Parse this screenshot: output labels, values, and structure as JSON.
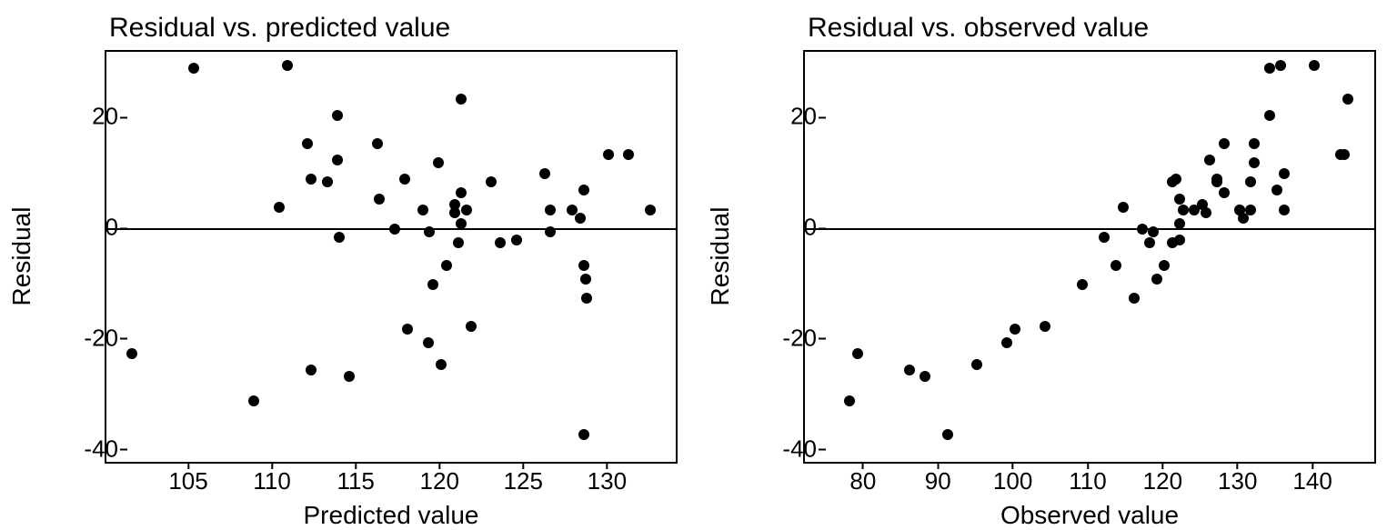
{
  "chart_data": [
    {
      "type": "scatter",
      "title": "Residual vs. predicted value",
      "xlabel": "Predicted value",
      "ylabel": "Residual",
      "xlim": [
        100,
        134
      ],
      "ylim": [
        -42,
        32
      ],
      "xticks": [
        105,
        110,
        115,
        120,
        125,
        130
      ],
      "yticks": [
        -40,
        -20,
        0,
        20
      ],
      "zero_line": 0,
      "points": [
        {
          "x": 101.5,
          "y": -22.5
        },
        {
          "x": 105.2,
          "y": 29
        },
        {
          "x": 108.8,
          "y": -31
        },
        {
          "x": 110.3,
          "y": 4
        },
        {
          "x": 110.8,
          "y": 29.5
        },
        {
          "x": 112.0,
          "y": 15.5
        },
        {
          "x": 112.2,
          "y": 9
        },
        {
          "x": 112.2,
          "y": -25.5
        },
        {
          "x": 113.2,
          "y": 8.5
        },
        {
          "x": 113.8,
          "y": 20.5
        },
        {
          "x": 113.8,
          "y": 12.5
        },
        {
          "x": 113.9,
          "y": -1.5
        },
        {
          "x": 114.5,
          "y": -26.5
        },
        {
          "x": 116.2,
          "y": 15.5
        },
        {
          "x": 116.3,
          "y": 5.5
        },
        {
          "x": 117.2,
          "y": 0
        },
        {
          "x": 117.8,
          "y": 9
        },
        {
          "x": 118.0,
          "y": -18
        },
        {
          "x": 118.9,
          "y": 3.5
        },
        {
          "x": 119.2,
          "y": -20.5
        },
        {
          "x": 119.3,
          "y": -0.5
        },
        {
          "x": 119.5,
          "y": -10
        },
        {
          "x": 119.8,
          "y": 12
        },
        {
          "x": 120.0,
          "y": -24.5
        },
        {
          "x": 120.3,
          "y": -6.5
        },
        {
          "x": 120.8,
          "y": 4.5
        },
        {
          "x": 120.8,
          "y": 3
        },
        {
          "x": 121.0,
          "y": -2.5
        },
        {
          "x": 121.2,
          "y": 23.5
        },
        {
          "x": 121.2,
          "y": 6.5
        },
        {
          "x": 121.2,
          "y": 1
        },
        {
          "x": 121.5,
          "y": 3.5
        },
        {
          "x": 121.8,
          "y": -17.5
        },
        {
          "x": 123.0,
          "y": 8.5
        },
        {
          "x": 123.5,
          "y": -2.5
        },
        {
          "x": 124.5,
          "y": -2
        },
        {
          "x": 126.2,
          "y": 10
        },
        {
          "x": 126.5,
          "y": 3.5
        },
        {
          "x": 126.5,
          "y": -0.5
        },
        {
          "x": 127.8,
          "y": 3.5
        },
        {
          "x": 128.3,
          "y": 2
        },
        {
          "x": 128.5,
          "y": 7
        },
        {
          "x": 128.5,
          "y": -6.5
        },
        {
          "x": 128.6,
          "y": -9
        },
        {
          "x": 128.7,
          "y": -12.5
        },
        {
          "x": 128.5,
          "y": -37
        },
        {
          "x": 130.0,
          "y": 13.5
        },
        {
          "x": 131.2,
          "y": 13.5
        },
        {
          "x": 132.5,
          "y": 3.5
        }
      ]
    },
    {
      "type": "scatter",
      "title": "Residual vs. observed value",
      "xlabel": "Observed value",
      "ylabel": "Residual",
      "xlim": [
        72,
        148
      ],
      "ylim": [
        -42,
        32
      ],
      "xticks": [
        80,
        90,
        100,
        110,
        120,
        130,
        140
      ],
      "yticks": [
        -40,
        -20,
        0,
        20
      ],
      "zero_line": 0,
      "points": [
        {
          "x": 78,
          "y": -31
        },
        {
          "x": 79,
          "y": -22.5
        },
        {
          "x": 86,
          "y": -25.5
        },
        {
          "x": 88,
          "y": -26.5
        },
        {
          "x": 91,
          "y": -37
        },
        {
          "x": 95,
          "y": -24.5
        },
        {
          "x": 99,
          "y": -20.5
        },
        {
          "x": 100,
          "y": -18
        },
        {
          "x": 104,
          "y": -17.5
        },
        {
          "x": 109,
          "y": -10
        },
        {
          "x": 112,
          "y": -1.5
        },
        {
          "x": 113.5,
          "y": -6.5
        },
        {
          "x": 114.5,
          "y": 4
        },
        {
          "x": 116,
          "y": -12.5
        },
        {
          "x": 117,
          "y": 0
        },
        {
          "x": 118,
          "y": -2.5
        },
        {
          "x": 118.5,
          "y": -0.5
        },
        {
          "x": 119,
          "y": -9
        },
        {
          "x": 120,
          "y": -6.5
        },
        {
          "x": 121,
          "y": 8.5
        },
        {
          "x": 121,
          "y": -2.5
        },
        {
          "x": 121.5,
          "y": 9
        },
        {
          "x": 122,
          "y": 5.5
        },
        {
          "x": 122,
          "y": 1
        },
        {
          "x": 122,
          "y": -2
        },
        {
          "x": 122.5,
          "y": 3.5
        },
        {
          "x": 124,
          "y": 3.5
        },
        {
          "x": 125,
          "y": 4.5
        },
        {
          "x": 125.5,
          "y": 3
        },
        {
          "x": 126,
          "y": 12.5
        },
        {
          "x": 127,
          "y": 8.5
        },
        {
          "x": 127,
          "y": 9
        },
        {
          "x": 128,
          "y": 15.5
        },
        {
          "x": 128,
          "y": 6.5
        },
        {
          "x": 130,
          "y": 3.5
        },
        {
          "x": 130,
          "y": 3.5
        },
        {
          "x": 130.5,
          "y": 2
        },
        {
          "x": 131.5,
          "y": 8.5
        },
        {
          "x": 131.5,
          "y": 3.5
        },
        {
          "x": 132,
          "y": 15.5
        },
        {
          "x": 132,
          "y": 12
        },
        {
          "x": 134,
          "y": 20.5
        },
        {
          "x": 134,
          "y": 29
        },
        {
          "x": 135,
          "y": 7
        },
        {
          "x": 135.5,
          "y": 29.5
        },
        {
          "x": 136,
          "y": 3.5
        },
        {
          "x": 136,
          "y": 10
        },
        {
          "x": 140,
          "y": 29.5
        },
        {
          "x": 143.5,
          "y": 13.5
        },
        {
          "x": 144,
          "y": 13.5
        },
        {
          "x": 144.5,
          "y": 23.5
        }
      ]
    }
  ]
}
